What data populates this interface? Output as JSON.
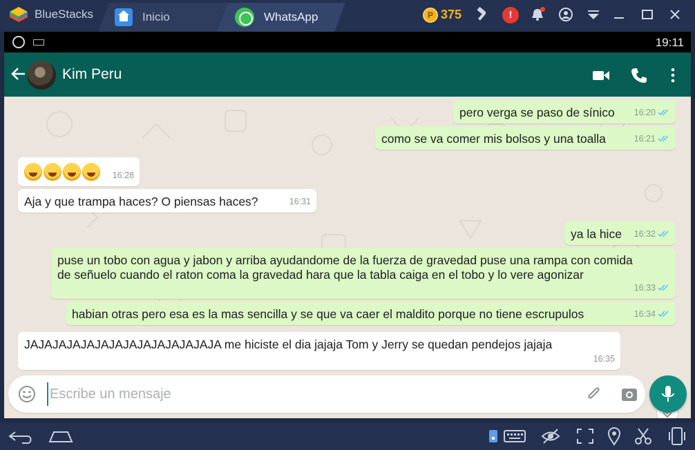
{
  "bluestacks": {
    "app_name": "BlueStacks",
    "tabs": [
      {
        "label": "Inicio"
      },
      {
        "label": "WhatsApp"
      }
    ],
    "coins": "375",
    "alert_symbol": "!"
  },
  "statusbar": {
    "time": "19:11"
  },
  "chat_header": {
    "contact_name": "Kim Peru"
  },
  "messages": [
    {
      "direction": "out",
      "text": "pero verga se paso de sínico",
      "time": "16:20",
      "read": true
    },
    {
      "direction": "out",
      "text": "como se va comer mis bolsos y una toalla",
      "time": "16:21",
      "read": true
    },
    {
      "direction": "in",
      "text": "",
      "emojis": 4,
      "time": "16:28"
    },
    {
      "direction": "in",
      "text": "Aja y que trampa haces?  O piensas haces?",
      "time": "16:31"
    },
    {
      "direction": "out",
      "text": "ya la hice",
      "time": "16:32",
      "read": true
    },
    {
      "direction": "out",
      "text": "puse un tobo con agua y jabon y arriba ayudandome de la fuerza de gravedad puse una rampa con comida de señuelo cuando el raton coma la gravedad hara que la tabla caiga en el tobo y lo vere agonizar",
      "time": "16:33",
      "read": true
    },
    {
      "direction": "out",
      "text": "habian otras pero esa es la mas sencilla y se que va caer el maldito porque no tiene escrupulos",
      "time": "16:34",
      "read": true
    },
    {
      "direction": "in",
      "text": "JAJAJAJAJAJAJAJAJAJAJAJAJAJA me hiciste el dia jajaja Tom y Jerry se quedan pendejos jajaja",
      "time": "16:35"
    }
  ],
  "composer": {
    "placeholder": "Escribe un mensaje"
  },
  "colors": {
    "header": "#075e54",
    "outgoing_bubble": "#dcf8c6",
    "incoming_bubble": "#ffffff",
    "chat_bg": "#ece5dd",
    "fab": "#128c7e",
    "read_ticks": "#4fc3f7",
    "bluestacks_bar": "#243150"
  }
}
